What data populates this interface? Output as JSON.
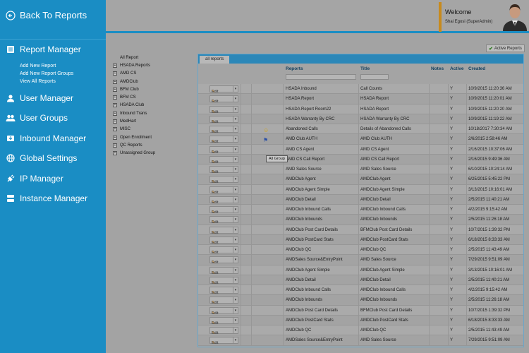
{
  "sidebar": {
    "back_label": "Back To Reports",
    "report_manager": "Report Manager",
    "sub_links": [
      "Add New Report",
      "Add New Report Groups",
      "View All Reports"
    ],
    "items": [
      {
        "label": "User Manager",
        "icon": "user-icon"
      },
      {
        "label": "User Groups",
        "icon": "users-icon"
      },
      {
        "label": "Inbound Manager",
        "icon": "inbound-icon"
      },
      {
        "label": "Global Settings",
        "icon": "globe-icon"
      },
      {
        "label": "IP Manager",
        "icon": "plug-icon"
      },
      {
        "label": "Instance Manager",
        "icon": "server-icon"
      }
    ]
  },
  "header": {
    "welcome": "Welcome",
    "user": "Shai Egosi (SuperAdmin)"
  },
  "tree": {
    "root": "All Report",
    "items": [
      "HSADA Reports",
      "AMD CS",
      "AMDClub",
      "BFM Club",
      "BFM CS",
      "HSADA Club",
      "Inbound Trans",
      "MedHart",
      "MISC",
      "Open Enrollment",
      "QC Reports",
      "Unassigned Group"
    ]
  },
  "active_button": "Active Reports",
  "tab_label": "all reports",
  "columns": {
    "reports": "Reports",
    "title": "Title",
    "notes": "Notes",
    "active": "Active",
    "created": "Created"
  },
  "edit_label": "Edit",
  "tooltip": "All Group",
  "rows": [
    {
      "report": "HSADA Inbound",
      "title": "Call Counts",
      "active": "Y",
      "created": "10/9/2015 11:20:36 AM",
      "icon": ""
    },
    {
      "report": "HSADA Report",
      "title": "HSADA Report",
      "active": "Y",
      "created": "10/9/2015 11:20:01 AM",
      "icon": ""
    },
    {
      "report": "HSADA Report Room22",
      "title": "HSADA Report",
      "active": "Y",
      "created": "10/9/2015 11:20:20 AM",
      "icon": ""
    },
    {
      "report": "HSADA Warranty By CRC",
      "title": "HSADA Warranty By CRC",
      "active": "Y",
      "created": "10/9/2015 11:19:22 AM",
      "icon": ""
    },
    {
      "report": "Abandoned Calls",
      "title": "Details of Abandoned Calls",
      "active": "Y",
      "created": "10/18/2017 7:30:34 AM",
      "icon": "user-badge-icon"
    },
    {
      "report": "AMD Club AUTH",
      "title": "AMD Club AUTH",
      "active": "Y",
      "created": "2/6/2015 2:58:46 AM",
      "icon": "flag-icon"
    },
    {
      "report": "AMD CS Agent",
      "title": "AMD CS Agent",
      "active": "Y",
      "created": "2/16/2015 10:37:06 AM",
      "icon": ""
    },
    {
      "report": "AMD CS Call Report",
      "title": "AMD CS Call Report",
      "active": "Y",
      "created": "2/16/2015 9:49:36 AM",
      "icon": ""
    },
    {
      "report": "AMD Sales Source",
      "title": "AMD Sales Source",
      "active": "Y",
      "created": "6/10/2015 10:24:14 AM",
      "icon": ""
    },
    {
      "report": "AMDClub Agent",
      "title": "AMDClub Agent",
      "active": "Y",
      "created": "6/25/2015 5:45:22 PM",
      "icon": ""
    },
    {
      "report": "AMDClub Agent Simple",
      "title": "AMDClub Agent Simple",
      "active": "Y",
      "created": "3/13/2015 10:16:01 AM",
      "icon": ""
    },
    {
      "report": "AMDClub Detail",
      "title": "AMDClub Detail",
      "active": "Y",
      "created": "2/5/2015 11:40:21 AM",
      "icon": ""
    },
    {
      "report": "AMDClub Inbound Calls",
      "title": "AMDClub Inbound Calls",
      "active": "Y",
      "created": "4/2/2015 9:15:42 AM",
      "icon": ""
    },
    {
      "report": "AMDClub Inbounds",
      "title": "AMDClub Inbounds",
      "active": "Y",
      "created": "2/5/2015 11:26:18 AM",
      "icon": ""
    },
    {
      "report": "AMDClub Post Card Details",
      "title": "BFMClub Post Card Details",
      "active": "Y",
      "created": "10/7/2015 1:39:32 PM",
      "icon": ""
    },
    {
      "report": "AMDClub PostCard Stats",
      "title": "AMDClub PostCard Stats",
      "active": "Y",
      "created": "6/18/2015 8:33:33 AM",
      "icon": ""
    },
    {
      "report": "AMDClub QC",
      "title": "AMDClub QC",
      "active": "Y",
      "created": "2/5/2015 11:43:49 AM",
      "icon": ""
    },
    {
      "report": "AMDSales Source&EntryPoint",
      "title": "AMD Sales Source",
      "active": "Y",
      "created": "7/29/2015 9:51:09 AM",
      "icon": ""
    },
    {
      "report": "AMDClub Agent Simple",
      "title": "AMDClub Agent Simple",
      "active": "Y",
      "created": "3/13/2015 10:16:01 AM",
      "icon": ""
    },
    {
      "report": "AMDClub Detail",
      "title": "AMDClub Detail",
      "active": "Y",
      "created": "2/5/2015 11:40:21 AM",
      "icon": ""
    },
    {
      "report": "AMDClub Inbound Calls",
      "title": "AMDClub Inbound Calls",
      "active": "Y",
      "created": "4/2/2015 9:15:42 AM",
      "icon": ""
    },
    {
      "report": "AMDClub Inbounds",
      "title": "AMDClub Inbounds",
      "active": "Y",
      "created": "2/5/2015 11:26:18 AM",
      "icon": ""
    },
    {
      "report": "AMDClub Post Card Details",
      "title": "BFMClub Post Card Details",
      "active": "Y",
      "created": "10/7/2015 1:39:32 PM",
      "icon": ""
    },
    {
      "report": "AMDClub PostCard Stats",
      "title": "AMDClub PostCard Stats",
      "active": "Y",
      "created": "6/18/2015 8:33:33 AM",
      "icon": ""
    },
    {
      "report": "AMDClub QC",
      "title": "AMDClub QC",
      "active": "Y",
      "created": "2/5/2015 11:43:49 AM",
      "icon": ""
    },
    {
      "report": "AMDSales Source&EntryPoint",
      "title": "AMD Sales Source",
      "active": "Y",
      "created": "7/29/2015 9:51:09 AM",
      "icon": ""
    }
  ]
}
